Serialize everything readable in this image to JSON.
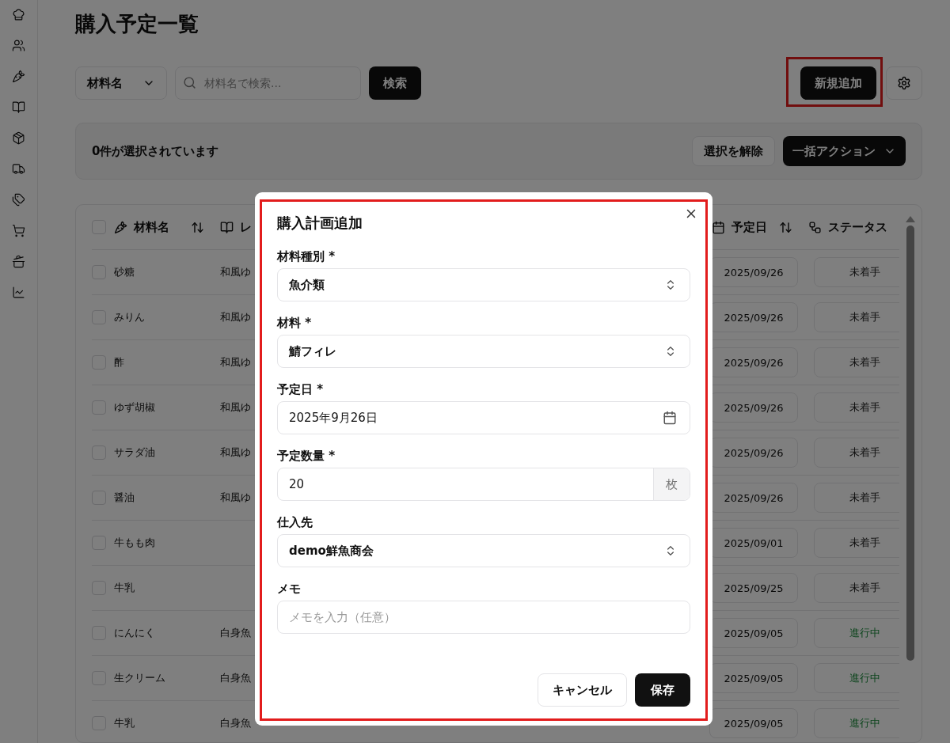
{
  "page": {
    "title": "購入予定一覧"
  },
  "toolbar": {
    "filter": "材料名",
    "search": {
      "placeholder": "材料名で検索..."
    },
    "search_button": "検索",
    "add_button": "新規追加"
  },
  "selection_bar": {
    "text": "0件が選択されています",
    "clear_button": "選択を解除",
    "bulk_button": "一括アクション"
  },
  "table": {
    "all_checked": false,
    "columns": [
      {
        "label": "材料名"
      },
      {
        "label": "レ"
      },
      {
        "label": "予定日"
      },
      {
        "label": "ステータス"
      }
    ],
    "rows": [
      {
        "checked": false,
        "name": "砂糖",
        "recipe": "和風ゆ",
        "date": "2025/09/26",
        "status": "未着手",
        "kind": "not_started"
      },
      {
        "checked": false,
        "name": "みりん",
        "recipe": "和風ゆ",
        "date": "2025/09/26",
        "status": "未着手",
        "kind": "not_started"
      },
      {
        "checked": false,
        "name": "酢",
        "recipe": "和風ゆ",
        "date": "2025/09/26",
        "status": "未着手",
        "kind": "not_started"
      },
      {
        "checked": false,
        "name": "ゆず胡椒",
        "recipe": "和風ゆ",
        "date": "2025/09/26",
        "status": "未着手",
        "kind": "not_started"
      },
      {
        "checked": false,
        "name": "サラダ油",
        "recipe": "和風ゆ",
        "date": "2025/09/26",
        "status": "未着手",
        "kind": "not_started"
      },
      {
        "checked": false,
        "name": "醤油",
        "recipe": "和風ゆ",
        "date": "2025/09/26",
        "status": "未着手",
        "kind": "not_started"
      },
      {
        "checked": false,
        "name": "牛もも肉",
        "date": "2025/09/01",
        "status": "未着手",
        "kind": "not_started"
      },
      {
        "checked": false,
        "name": "牛乳",
        "date": "2025/09/25",
        "status": "未着手",
        "kind": "not_started"
      },
      {
        "checked": false,
        "name": "にんにく",
        "recipe": "白身魚",
        "date": "2025/09/05",
        "status": "進行中",
        "kind": "in_progress"
      },
      {
        "checked": false,
        "name": "生クリーム",
        "recipe": "白身魚",
        "date": "2025/09/05",
        "status": "進行中",
        "kind": "in_progress"
      },
      {
        "checked": false,
        "name": "牛乳",
        "recipe": "白身魚",
        "date": "2025/09/05",
        "status": "進行中",
        "kind": "in_progress"
      }
    ]
  },
  "dialog": {
    "title": "購入計画追加",
    "fields": [
      {
        "kind": "select",
        "label": "材料種別 *",
        "value": "魚介類"
      },
      {
        "kind": "select",
        "label": "材料 *",
        "value": "鯖フィレ"
      },
      {
        "kind": "date",
        "label": "予定日 *",
        "value": "2025年9月26日"
      },
      {
        "kind": "number",
        "label": "予定数量 *",
        "value": "20",
        "unit": "枚"
      },
      {
        "kind": "select",
        "label": "仕入先",
        "value": "demo鮮魚商会"
      },
      {
        "kind": "text",
        "label": "メモ",
        "placeholder": "メモを入力（任意）"
      }
    ],
    "cancel_button": "キャンセル",
    "save_button": "保存"
  }
}
